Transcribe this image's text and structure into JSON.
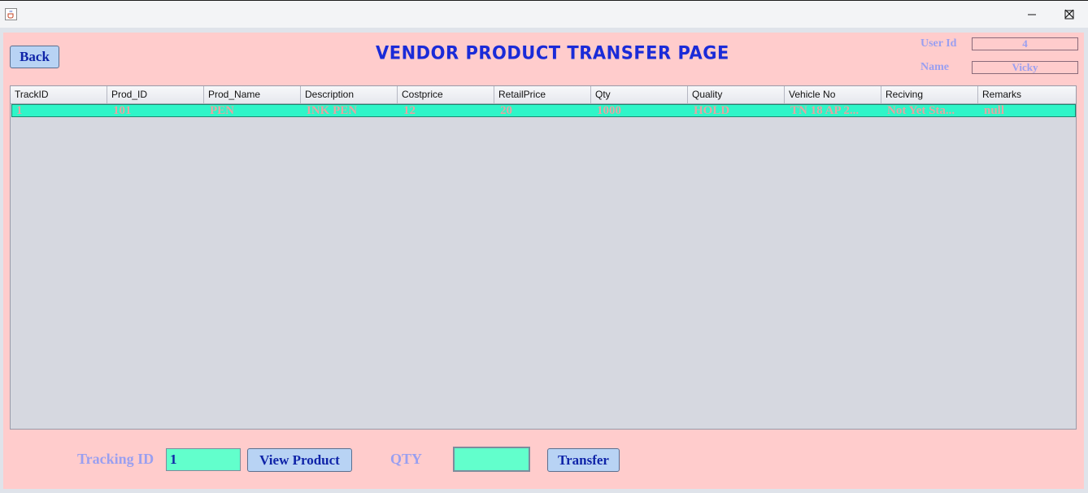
{
  "window": {
    "app_icon": "java-coffee-icon",
    "controls": [
      "minimize-icon",
      "maximize-icon",
      "close-icon"
    ]
  },
  "header": {
    "back_label": "Back",
    "title": "VENDOR PRODUCT TRANSFER PAGE"
  },
  "user_info": {
    "user_id_label": "User Id",
    "user_id_value": "4",
    "name_label": "Name",
    "name_value": "Vicky"
  },
  "table": {
    "columns": [
      "TrackID",
      "Prod_ID",
      "Prod_Name",
      "Description",
      "Costprice",
      "RetailPrice",
      "Qty",
      "Quality",
      "Vehicle No",
      "Reciving",
      "Remarks"
    ],
    "rows": [
      [
        "1",
        "101",
        "PEN",
        "INK PEN",
        "12",
        "20",
        "1000",
        "HOLD",
        "TN 18 AP 2...",
        "Not Yet Sta...",
        "null"
      ]
    ]
  },
  "footer": {
    "tracking_label": "Tracking ID",
    "tracking_value": "1",
    "view_button": "View Product",
    "qty_label": "QTY",
    "qty_value": "",
    "transfer_button": "Transfer"
  },
  "colors": {
    "background": "#ffcccc",
    "title": "#1a2bd8",
    "selected_row": "#2ff5c8",
    "button": "#b8d3f4",
    "label": "#9a9ff0"
  }
}
